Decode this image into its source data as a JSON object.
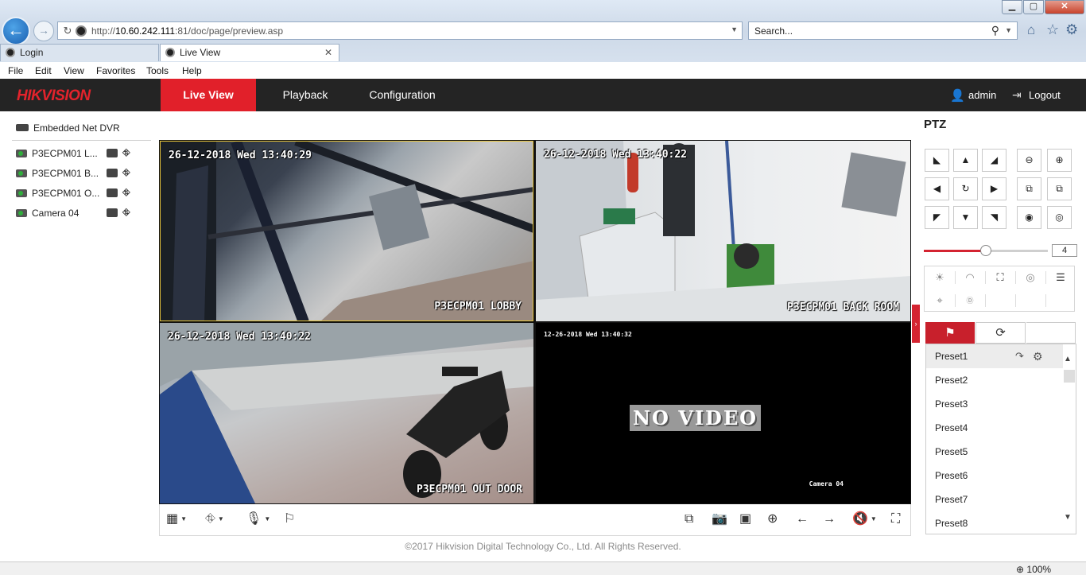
{
  "browser": {
    "url_prefix": "http://",
    "url_host": "10.60.242.111",
    "url_rest": ":81/doc/page/preview.asp",
    "search_placeholder": "Search...",
    "tabs": [
      {
        "label": "Login"
      },
      {
        "label": "Live View"
      }
    ],
    "menu": [
      "File",
      "Edit",
      "View",
      "Favorites",
      "Tools",
      "Help"
    ],
    "zoom": "100%"
  },
  "app": {
    "logo": "HIK",
    "logo_rest": "VISION",
    "nav": [
      "Live View",
      "Playback",
      "Configuration"
    ],
    "active_nav": "Live View",
    "user": "admin",
    "logout": "Logout",
    "accent_color": "#e1202a"
  },
  "device": {
    "name": "Embedded Net DVR",
    "cameras": [
      {
        "label": "P3ECPM01 L..."
      },
      {
        "label": "P3ECPM01 B..."
      },
      {
        "label": "P3ECPM01 O..."
      },
      {
        "label": "Camera 04"
      }
    ]
  },
  "video": {
    "tiles": [
      {
        "timestamp": "26-12-2018 Wed 13:40:29",
        "name": "P3ECPM01 LOBBY"
      },
      {
        "timestamp": "26-12-2018 Wed 13:40:22",
        "name": "P3ECPM01 BACK ROOM"
      },
      {
        "timestamp": "26-12-2018 Wed 13:40:22",
        "name": "P3ECPM01 OUT DOOR"
      },
      {
        "timestamp": "12-26-2018 Wed 13:40:32",
        "name": "Camera 04",
        "overlay": "NO VIDEO"
      }
    ]
  },
  "footer": "©2017 Hikvision Digital Technology Co., Ltd. All Rights Reserved.",
  "ptz": {
    "title": "PTZ",
    "speed": "4",
    "speed_level": 0.5,
    "presets": [
      "Preset1",
      "Preset2",
      "Preset3",
      "Preset4",
      "Preset5",
      "Preset6",
      "Preset7",
      "Preset8"
    ]
  }
}
